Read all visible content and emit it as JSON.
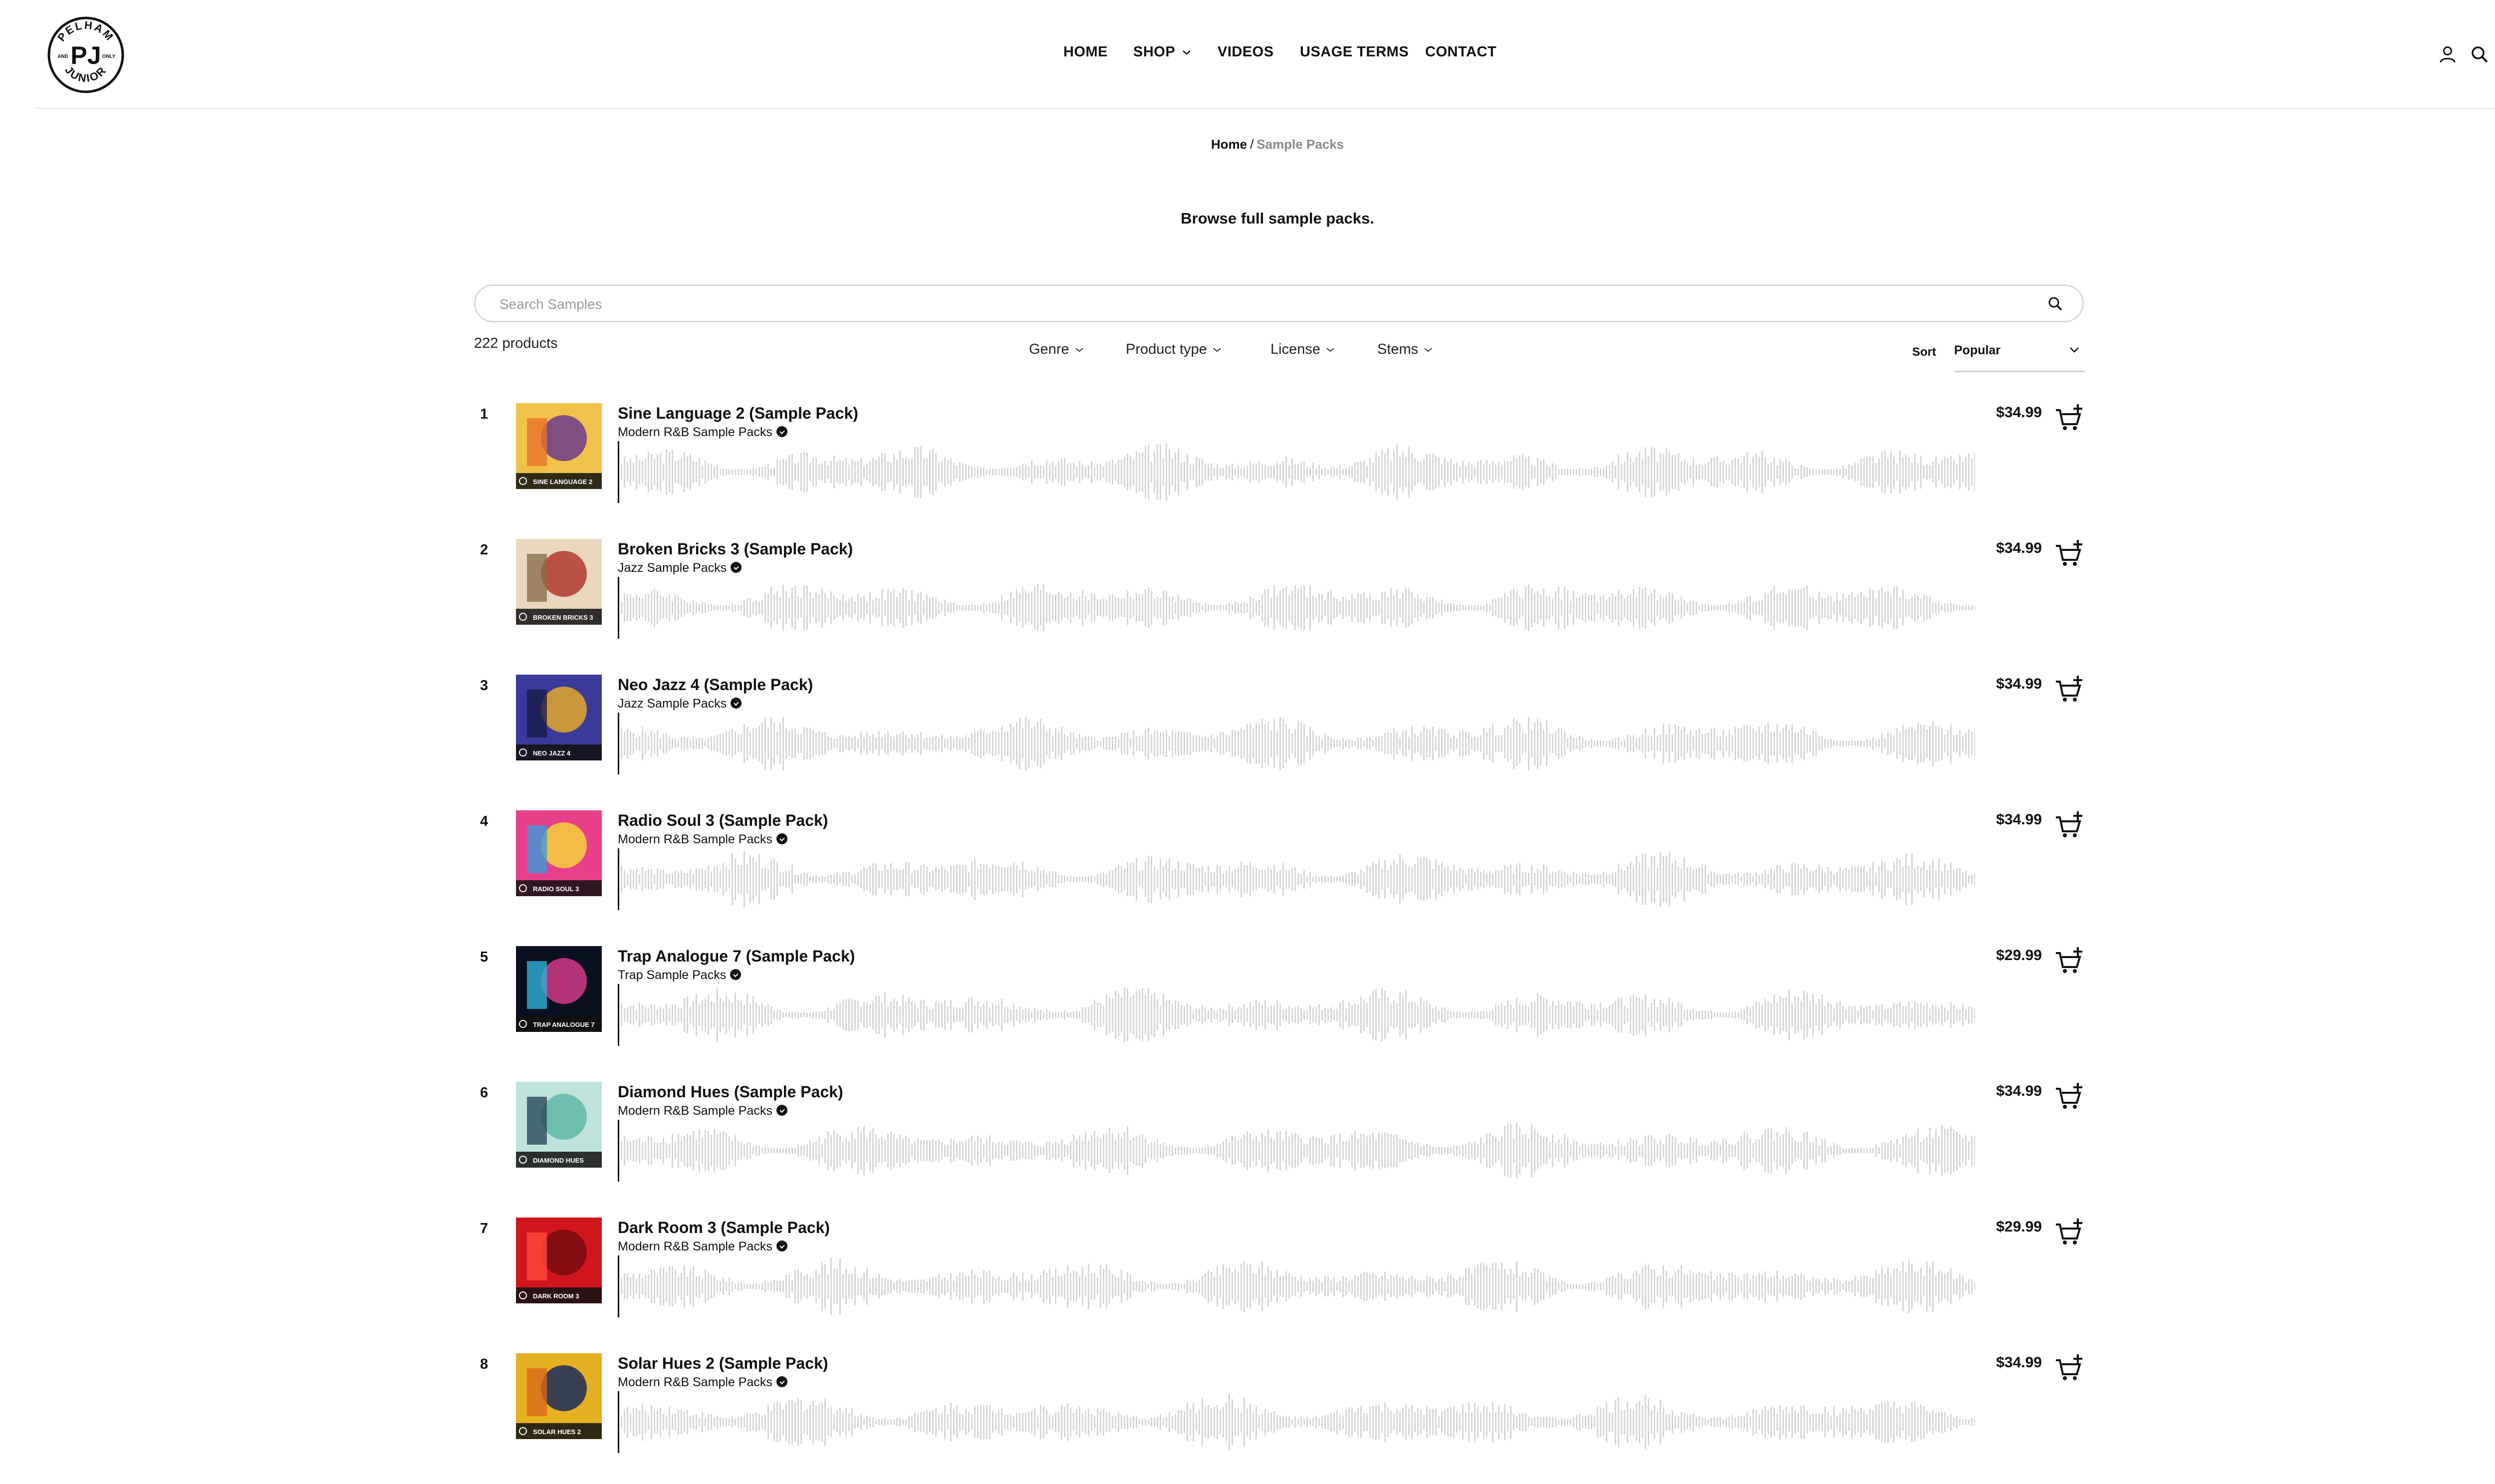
{
  "header": {
    "logo": {
      "text_top": "PELHAM",
      "text_bottom": "JUNIOR",
      "monogram": "PJ",
      "side_left": "AND",
      "side_right": "ONLY",
      "icon": "logo-badge"
    },
    "nav": [
      {
        "label": "HOME"
      },
      {
        "label": "SHOP",
        "has_dropdown": true
      },
      {
        "label": "VIDEOS"
      },
      {
        "label": "USAGE TERMS"
      },
      {
        "label": "CONTACT"
      }
    ],
    "icons": [
      "account-icon",
      "search-icon",
      "cart-icon"
    ]
  },
  "breadcrumb": {
    "home": "Home",
    "separator": "/",
    "current": "Sample Packs"
  },
  "tagline": "Browse full sample packs.",
  "search": {
    "placeholder": "Search Samples",
    "value": ""
  },
  "toolbar": {
    "count": "222 products",
    "filters": [
      "Genre",
      "Product type",
      "License",
      "Stems"
    ],
    "sort_label": "Sort",
    "sort_value": "Popular"
  },
  "products": [
    {
      "index": "1",
      "title": "Sine Language 2 (Sample Pack)",
      "category": "Modern R&B Sample Packs",
      "price": "$34.99",
      "cover_text": "SINE LANGUAGE 2",
      "cover_colors": [
        "#f0c24a",
        "#6c3a8a",
        "#e9732b"
      ]
    },
    {
      "index": "2",
      "title": "Broken Bricks 3 (Sample Pack)",
      "category": "Jazz Sample Packs",
      "price": "$34.99",
      "cover_text": "BROKEN BRICKS 3",
      "cover_colors": [
        "#e9d7c0",
        "#b03a2e",
        "#8a6f4a"
      ]
    },
    {
      "index": "3",
      "title": "Neo Jazz 4 (Sample Pack)",
      "category": "Jazz Sample Packs",
      "price": "$34.99",
      "cover_text": "NEO JAZZ 4",
      "cover_colors": [
        "#3a3a9a",
        "#e4a82a",
        "#1c1c4a"
      ]
    },
    {
      "index": "4",
      "title": "Radio Soul 3 (Sample Pack)",
      "category": "Modern R&B Sample Packs",
      "price": "$34.99",
      "cover_text": "RADIO SOUL 3",
      "cover_colors": [
        "#e83f8a",
        "#f4d23a",
        "#3d9ad8"
      ]
    },
    {
      "index": "5",
      "title": "Trap Analogue 7 (Sample Pack)",
      "category": "Trap Sample Packs",
      "price": "$29.99",
      "cover_text": "TRAP ANALOGUE 7",
      "cover_colors": [
        "#0b1020",
        "#d43a8a",
        "#2fb0d8"
      ]
    },
    {
      "index": "6",
      "title": "Diamond Hues (Sample Pack)",
      "category": "Modern R&B Sample Packs",
      "price": "$34.99",
      "cover_text": "DIAMOND HUES",
      "cover_colors": [
        "#bfe3dc",
        "#5fb8a8",
        "#2a4a5a"
      ]
    },
    {
      "index": "7",
      "title": "Dark Room 3 (Sample Pack)",
      "category": "Modern R&B Sample Packs",
      "price": "$29.99",
      "cover_text": "DARK ROOM 3",
      "cover_colors": [
        "#d0161c",
        "#7a0a10",
        "#ff4a3a"
      ]
    },
    {
      "index": "8",
      "title": "Solar Hues 2 (Sample Pack)",
      "category": "Modern R&B Sample Packs",
      "price": "$34.99",
      "cover_text": "SOLAR HUES 2",
      "cover_colors": [
        "#e6b023",
        "#1b2a5a",
        "#d86a1a"
      ]
    }
  ],
  "colors": {
    "text": "#111111",
    "muted": "#8a8a8a",
    "waveform": "#d6d6d6",
    "rule": "#e2e2e2"
  }
}
